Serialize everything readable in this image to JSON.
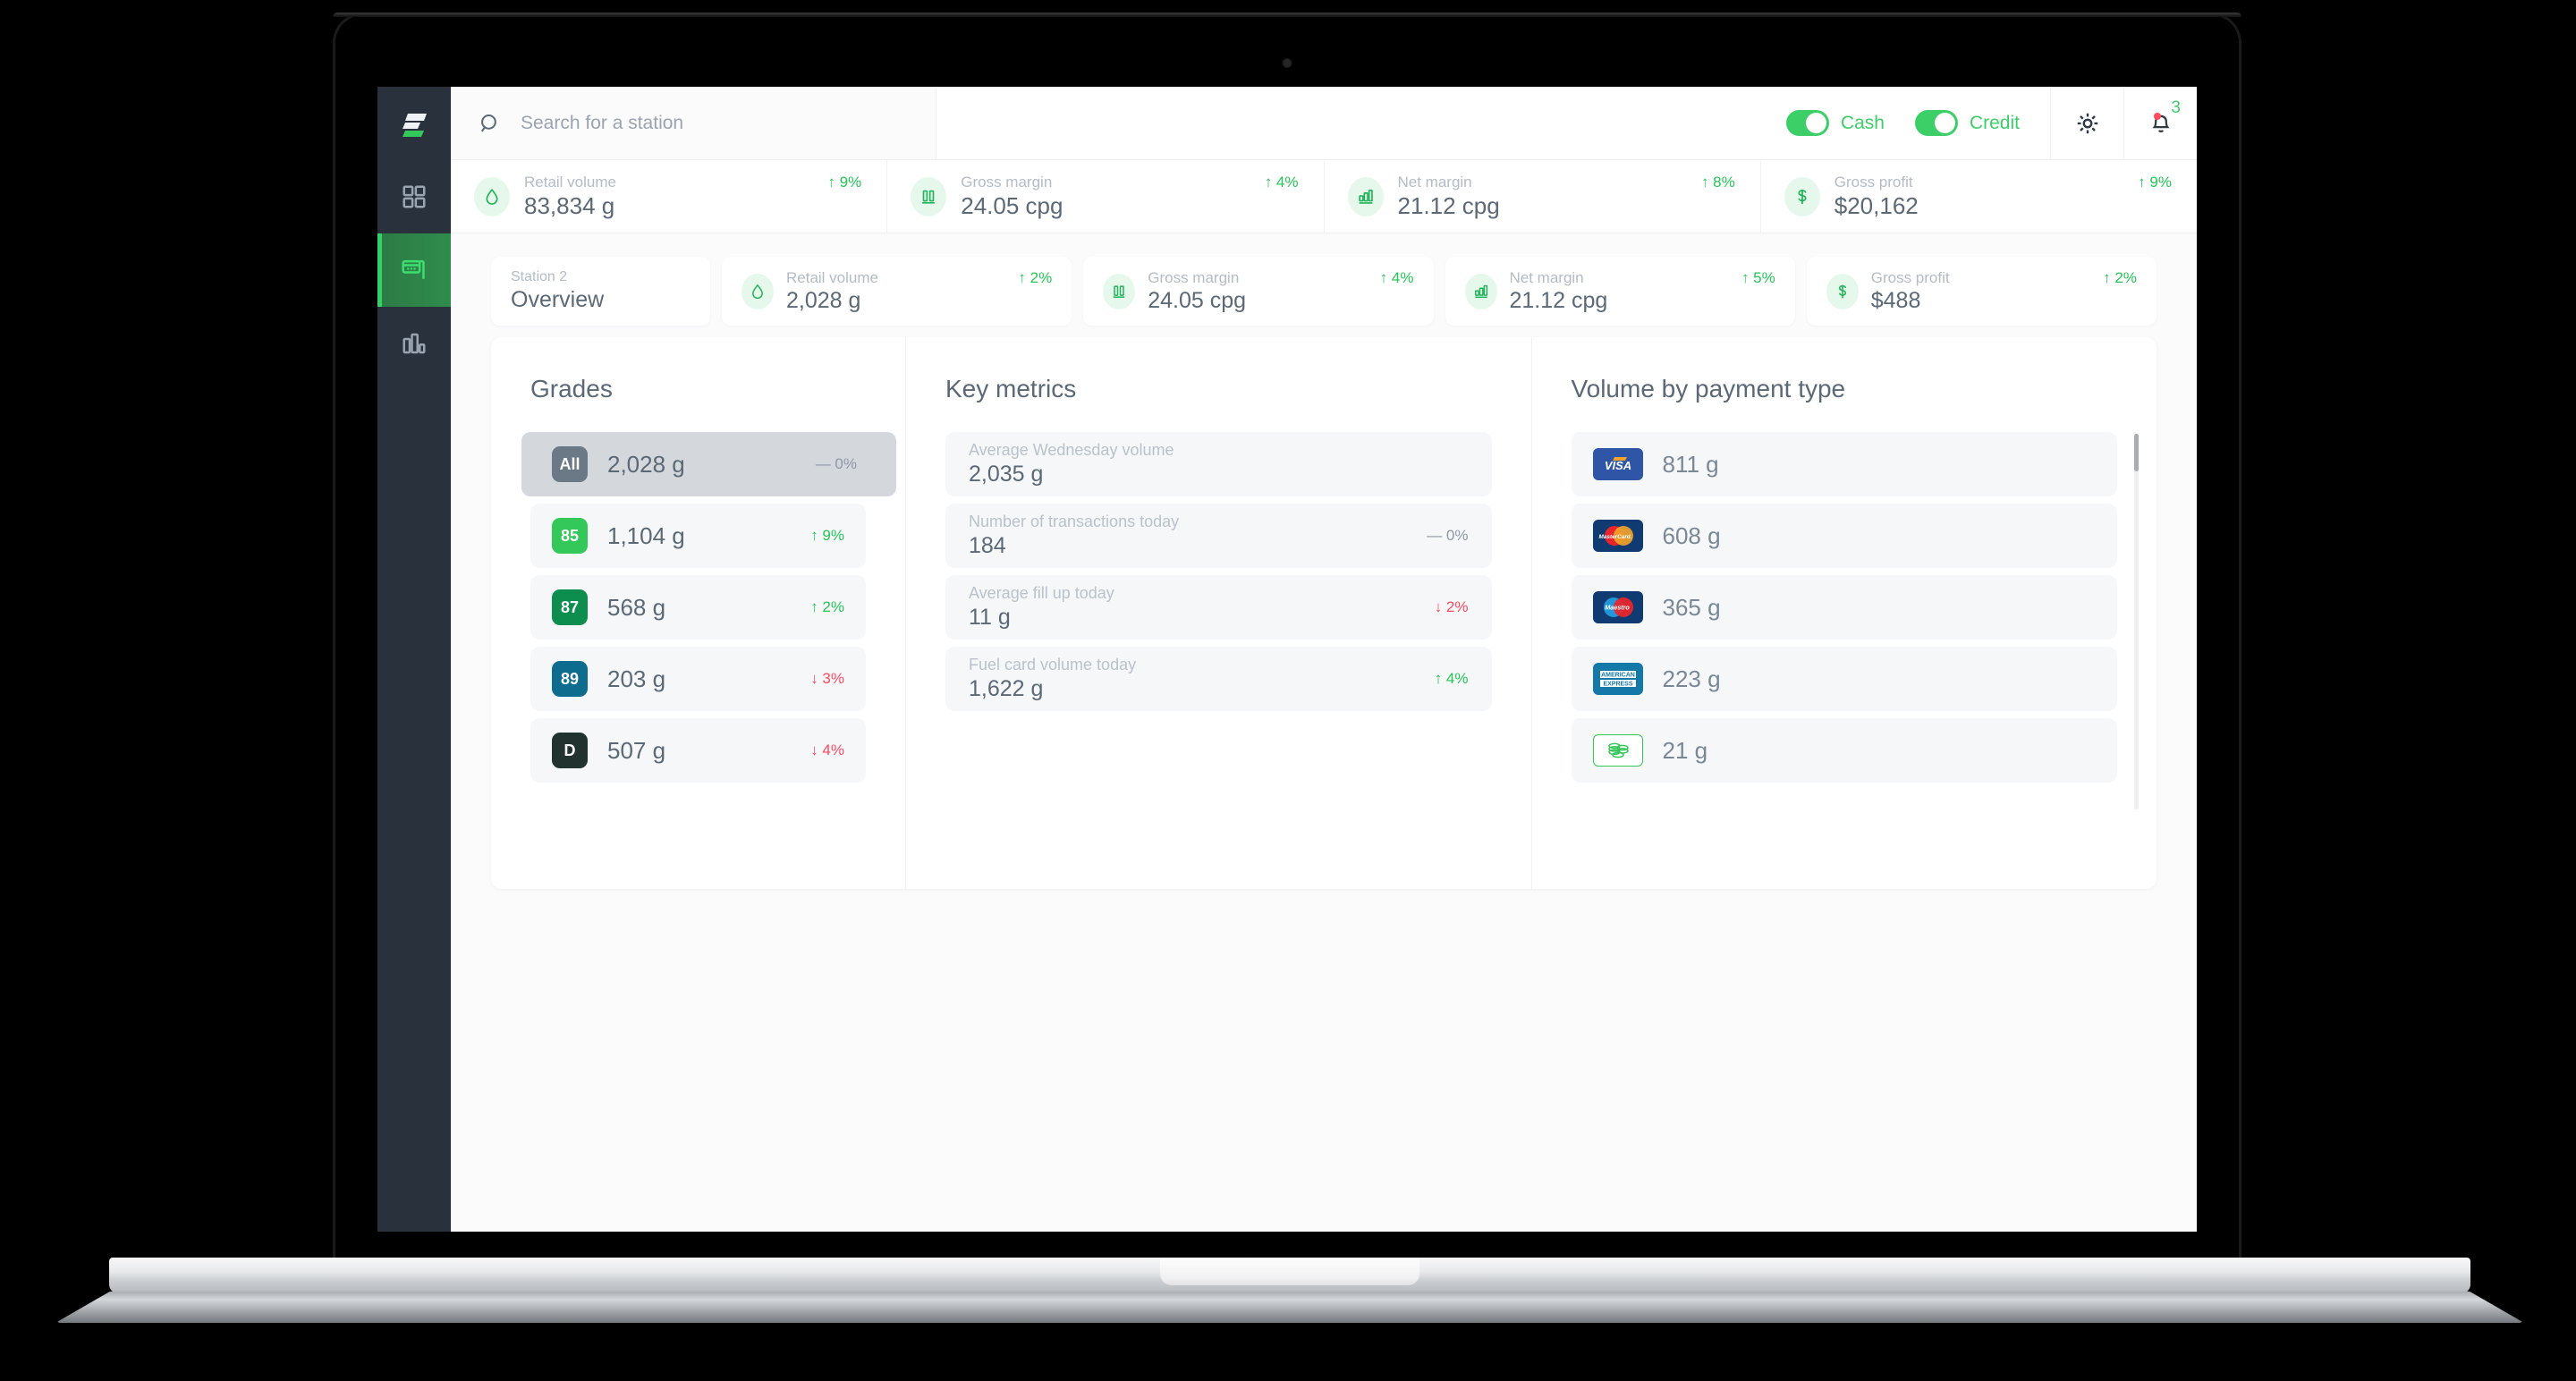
{
  "app": {
    "logo_name": "fuel-brand-logo"
  },
  "sidebar": {
    "items": [
      {
        "name": "dashboard",
        "icon": "grid-icon",
        "active": false
      },
      {
        "name": "stations",
        "icon": "station-sign-icon",
        "active": true
      },
      {
        "name": "reports",
        "icon": "bar-chart-icon",
        "active": false
      }
    ]
  },
  "header": {
    "search_placeholder": "Search for a station",
    "toggles": [
      {
        "label": "Cash",
        "on": true
      },
      {
        "label": "Credit",
        "on": true
      }
    ],
    "settings_icon": "gear-icon",
    "notifications_icon": "bell-icon",
    "notification_count": "3"
  },
  "kpi_strip": [
    {
      "icon": "fuel-drop-icon",
      "label": "Retail volume",
      "value": "83,834 g",
      "delta": "9%",
      "dir": "up"
    },
    {
      "icon": "gross-margin-icon",
      "label": "Gross margin",
      "value": "24.05 cpg",
      "delta": "4%",
      "dir": "up"
    },
    {
      "icon": "net-margin-icon",
      "label": "Net margin",
      "value": "21.12 cpg",
      "delta": "8%",
      "dir": "up"
    },
    {
      "icon": "dollar-icon",
      "label": "Gross profit",
      "value": "$20,162",
      "delta": "9%",
      "dir": "up"
    }
  ],
  "station_tab": {
    "subtitle": "Station 2",
    "title": "Overview"
  },
  "station_metrics": [
    {
      "icon": "fuel-drop-icon",
      "label": "Retail volume",
      "value": "2,028 g",
      "delta": "2%",
      "dir": "up"
    },
    {
      "icon": "gross-margin-icon",
      "label": "Gross margin",
      "value": "24.05 cpg",
      "delta": "4%",
      "dir": "up"
    },
    {
      "icon": "net-margin-icon",
      "label": "Net margin",
      "value": "21.12 cpg",
      "delta": "5%",
      "dir": "up"
    },
    {
      "icon": "dollar-icon",
      "label": "Gross profit",
      "value": "$488",
      "delta": "2%",
      "dir": "up"
    }
  ],
  "grades": {
    "title": "Grades",
    "rows": [
      {
        "badge": "All",
        "badge_color": "#6b7885",
        "value": "2,028 g",
        "delta": "0%",
        "dir": "flat",
        "selected": true
      },
      {
        "badge": "85",
        "badge_color": "#34c759",
        "value": "1,104 g",
        "delta": "9%",
        "dir": "up",
        "selected": false
      },
      {
        "badge": "87",
        "badge_color": "#0e8e4e",
        "value": "568 g",
        "delta": "2%",
        "dir": "up",
        "selected": false
      },
      {
        "badge": "89",
        "badge_color": "#0e6d8e",
        "value": "203 g",
        "delta": "3%",
        "dir": "down",
        "selected": false
      },
      {
        "badge": "D",
        "badge_color": "#22332f",
        "value": "507 g",
        "delta": "4%",
        "dir": "down",
        "selected": false
      }
    ]
  },
  "key_metrics": {
    "title": "Key metrics",
    "rows": [
      {
        "label": "Average Wednesday volume",
        "value": "2,035 g",
        "delta": "",
        "dir": "none"
      },
      {
        "label": "Number of transactions today",
        "value": "184",
        "delta": "0%",
        "dir": "flat"
      },
      {
        "label": "Average fill up today",
        "value": "11 g",
        "delta": "2%",
        "dir": "down"
      },
      {
        "label": "Fuel card volume today",
        "value": "1,622 g",
        "delta": "4%",
        "dir": "up"
      }
    ]
  },
  "payments": {
    "title": "Volume by payment type",
    "rows": [
      {
        "logo": "visa-logo",
        "value": "811 g"
      },
      {
        "logo": "mastercard-logo",
        "value": "608 g"
      },
      {
        "logo": "maestro-logo",
        "value": "365 g"
      },
      {
        "logo": "amex-logo",
        "value": "223 g"
      },
      {
        "logo": "cash-coins-logo",
        "value": "21 g"
      }
    ]
  },
  "colors": {
    "accent_green": "#34c759",
    "positive": "#25c557",
    "negative": "#fa4a5f",
    "neutral": "#8e99a5",
    "sidebar_bg": "#29323c",
    "text_primary": "#5b6876",
    "text_muted": "#b3bcc6"
  }
}
